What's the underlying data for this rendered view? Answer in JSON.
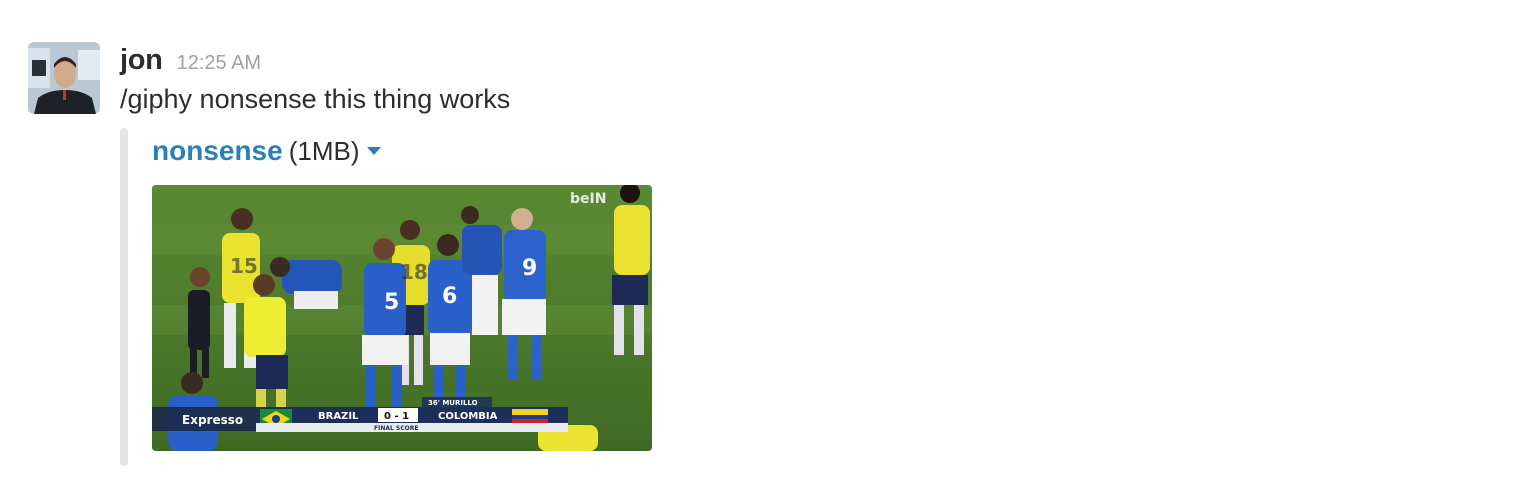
{
  "message": {
    "author": "jon",
    "timestamp": "12:25 AM",
    "text": "/giphy nonsense this thing works"
  },
  "attachment": {
    "title": "nonsense",
    "size": "(1MB)",
    "menu_icon": "caret-down-icon",
    "image": {
      "broadcaster_logo": "beIN",
      "corner_logo": "Expresso",
      "scoreboard": {
        "team_home": "BRAZIL",
        "score": "0 - 1",
        "team_away": "COLOMBIA",
        "caption": "FINAL SCORE",
        "goal_note": "36' MURILLO"
      }
    }
  },
  "colors": {
    "link": "#2a80b9",
    "text": "#2c2d30",
    "timestamp": "#9e9ea6",
    "attachment_bar": "#e3e4e6",
    "pitch": "#4e7a2b"
  }
}
